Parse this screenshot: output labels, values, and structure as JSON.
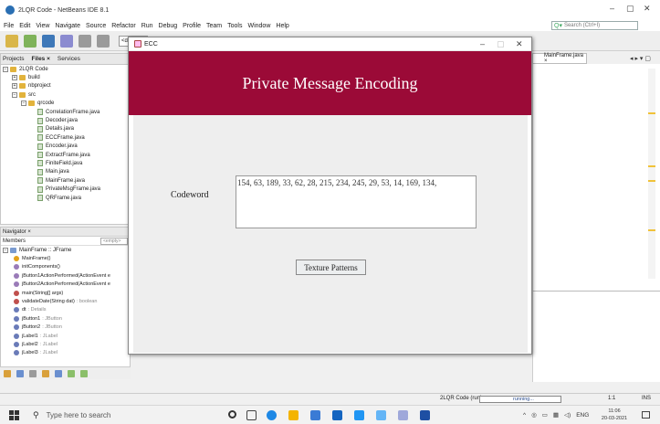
{
  "ide": {
    "title": "2LQR Code - NetBeans IDE 8.1",
    "menu": [
      "File",
      "Edit",
      "View",
      "Navigate",
      "Source",
      "Refactor",
      "Run",
      "Debug",
      "Profile",
      "Team",
      "Tools",
      "Window",
      "Help"
    ],
    "search_placeholder": "Search (Ctrl+I)",
    "config_combo": "<default"
  },
  "projects_panel": {
    "tabs": [
      "Projects",
      "Files ×",
      "Services"
    ],
    "tree": [
      {
        "label": "2LQR Code",
        "kind": "folder",
        "depth": 0,
        "expander": "−"
      },
      {
        "label": "build",
        "kind": "folder",
        "depth": 1,
        "expander": "+"
      },
      {
        "label": "nbproject",
        "kind": "folder",
        "depth": 1,
        "expander": "+"
      },
      {
        "label": "src",
        "kind": "folder",
        "depth": 1,
        "expander": "−"
      },
      {
        "label": "qrcode",
        "kind": "folder",
        "depth": 2,
        "expander": "−"
      },
      {
        "label": "CorrelationFrame.java",
        "kind": "file",
        "depth": 3,
        "expander": ""
      },
      {
        "label": "Decoder.java",
        "kind": "file",
        "depth": 3,
        "expander": ""
      },
      {
        "label": "Details.java",
        "kind": "file",
        "depth": 3,
        "expander": ""
      },
      {
        "label": "ECCFrame.java",
        "kind": "file",
        "depth": 3,
        "expander": ""
      },
      {
        "label": "Encoder.java",
        "kind": "file",
        "depth": 3,
        "expander": ""
      },
      {
        "label": "ExtractFrame.java",
        "kind": "file",
        "depth": 3,
        "expander": ""
      },
      {
        "label": "FiniteField.java",
        "kind": "file",
        "depth": 3,
        "expander": ""
      },
      {
        "label": "Main.java",
        "kind": "file",
        "depth": 3,
        "expander": ""
      },
      {
        "label": "MainFrame.java",
        "kind": "file",
        "depth": 3,
        "expander": ""
      },
      {
        "label": "PrivateMsgFrame.java",
        "kind": "file",
        "depth": 3,
        "expander": ""
      },
      {
        "label": "QRFrame.java",
        "kind": "file",
        "depth": 3,
        "expander": ""
      }
    ]
  },
  "navigator": {
    "title": "Navigator ×",
    "members_label": "Members",
    "filter": "<empty>",
    "root": "MainFrame :: JFrame",
    "members": [
      {
        "name": "MainFrame()",
        "type": "",
        "color": "#e3a21a"
      },
      {
        "name": "initComponents()",
        "type": "",
        "color": "#9a7bb8"
      },
      {
        "name": "jButton1ActionPerformed(ActionEvent e",
        "type": "",
        "color": "#9a7bb8"
      },
      {
        "name": "jButton2ActionPerformed(ActionEvent e",
        "type": "",
        "color": "#9a7bb8"
      },
      {
        "name": "main(String[] args)",
        "type": "",
        "color": "#c0504d"
      },
      {
        "name": "validateDate(String dat)",
        "type": ": boolean",
        "color": "#c0504d"
      },
      {
        "name": "dt",
        "type": ": Details",
        "color": "#6a7bb8"
      },
      {
        "name": "jButton1",
        "type": ": JButton",
        "color": "#6a7bb8"
      },
      {
        "name": "jButton2",
        "type": ": JButton",
        "color": "#6a7bb8"
      },
      {
        "name": "jLabel1",
        "type": ": JLabel",
        "color": "#6a7bb8"
      },
      {
        "name": "jLabel2",
        "type": ": JLabel",
        "color": "#6a7bb8"
      },
      {
        "name": "jLabel3",
        "type": ": JLabel",
        "color": "#6a7bb8"
      }
    ]
  },
  "editor": {
    "tab_label": "MainFrame.java ×"
  },
  "status_bar": {
    "run_label": "2LQR Code (run)",
    "progress_text": "running...",
    "position": "1:1",
    "mode": "INS"
  },
  "ecc_window": {
    "title": "ECC",
    "banner_title": "Private Message Encoding",
    "codeword_label": "Codeword",
    "codeword_value": "154, 63, 189, 33, 62, 28, 215, 234, 245, 29, 53, 14, 169, 134,",
    "button_label": "Texture Patterns",
    "banner_color": "#9b0a37"
  },
  "taskbar": {
    "search_placeholder": "Type here to search",
    "tray_lang": "ENG",
    "time": "11:06",
    "date": "20-03-2021"
  }
}
